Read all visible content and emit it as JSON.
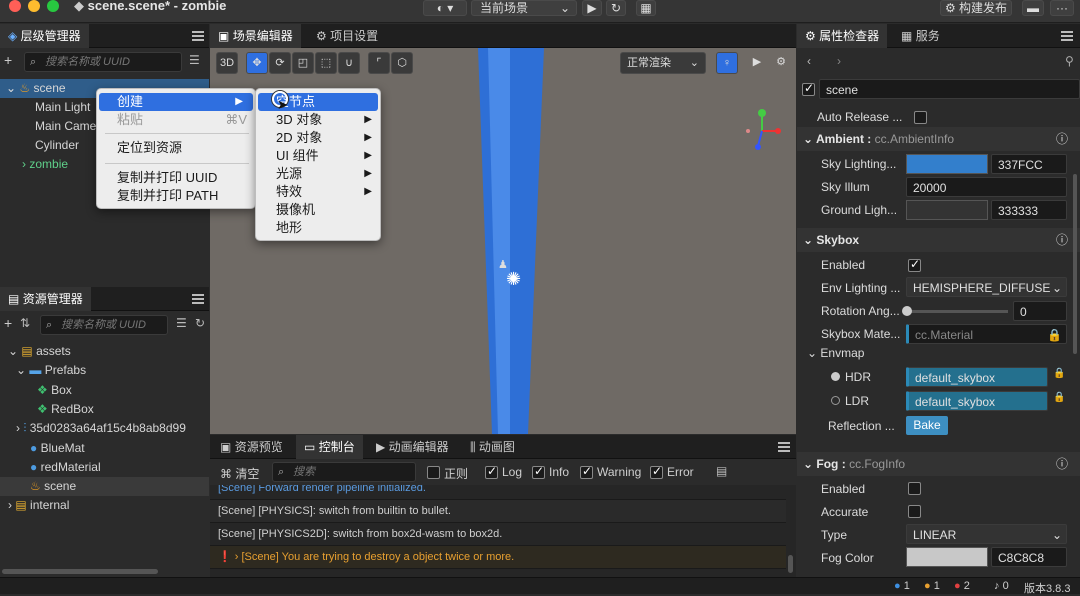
{
  "titlebar": {
    "title": "scene.scene* - zombie",
    "scene_select": "当前场景",
    "build_button": "构建发布"
  },
  "hierarchy": {
    "tab": "层级管理器",
    "search_placeholder": "搜索名称或 UUID",
    "items": [
      "scene",
      "Main Light",
      "Main Came",
      "Cylinder",
      "zombie"
    ]
  },
  "context_menu": {
    "items": [
      "创建",
      "粘贴",
      "定位到资源",
      "复制并打印 UUID",
      "复制并打印 PATH"
    ],
    "paste_shortcut": "⌘V"
  },
  "submenu": {
    "items": [
      "空节点",
      "3D 对象",
      "2D 对象",
      "UI 组件",
      "光源",
      "特效",
      "摄像机",
      "地形"
    ]
  },
  "assets": {
    "tab": "资源管理器",
    "search_placeholder": "搜索名称或 UUID",
    "items": [
      "assets",
      "Prefabs",
      "Box",
      "RedBox",
      "35d0283a64af15c4b8ab8d99",
      "BlueMat",
      "redMaterial",
      "scene",
      "internal"
    ]
  },
  "scene_editor": {
    "tab_scene": "场景编辑器",
    "tab_project": "项目设置",
    "mode_3d": "3D",
    "render_mode": "正常渲染"
  },
  "console": {
    "tabs": [
      "资源预览",
      "控制台",
      "动画编辑器",
      "动画图"
    ],
    "clear": "清空",
    "search_placeholder": "搜索",
    "filters": [
      "正则",
      "Log",
      "Info",
      "Warning",
      "Error"
    ],
    "lines": [
      "[Scene] Forward render pipeline initialized.",
      "[Scene] [PHYSICS]: switch from builtin to bullet.",
      "[Scene] [PHYSICS2D]: switch from box2d-wasm to box2d.",
      "[Scene] You are trying to destroy a object twice or more."
    ]
  },
  "inspector": {
    "tab": "属性检查器",
    "tab_services": "服务",
    "node_name": "scene",
    "auto_release": "Auto Release ...",
    "ambient": {
      "title": "Ambient",
      "type": "cc.AmbientInfo",
      "sky_lighting_label": "Sky Lighting...",
      "sky_lighting_hex": "337FCC",
      "sky_illum_label": "Sky Illum",
      "sky_illum_value": "20000",
      "ground_label": "Ground Ligh...",
      "ground_hex": "333333"
    },
    "skybox": {
      "title": "Skybox",
      "enabled_label": "Enabled",
      "env_label": "Env Lighting ...",
      "env_value": "HEMISPHERE_DIFFUSE",
      "rotation_label": "Rotation Ang...",
      "rotation_value": "0",
      "material_label": "Skybox Mate...",
      "material_value": "cc.Material",
      "envmap_label": "Envmap",
      "hdr_label": "HDR",
      "hdr_value": "default_skybox",
      "ldr_label": "LDR",
      "ldr_value": "default_skybox",
      "reflection_label": "Reflection ...",
      "bake_button": "Bake"
    },
    "fog": {
      "title": "Fog",
      "type": "cc.FogInfo",
      "enabled_label": "Enabled",
      "accurate_label": "Accurate",
      "type_label": "Type",
      "type_value": "LINEAR",
      "color_label": "Fog Color",
      "color_hex": "C8C8C8"
    }
  },
  "statusbar": {
    "info_count": "1",
    "warn_count": "1",
    "error_count": "2",
    "notify_count": "0",
    "version": "版本3.8.3"
  },
  "colors": {
    "accent": "#2f6fe0",
    "sky": "#337FCC",
    "ground": "#333333",
    "fog": "#C8C8C8"
  }
}
